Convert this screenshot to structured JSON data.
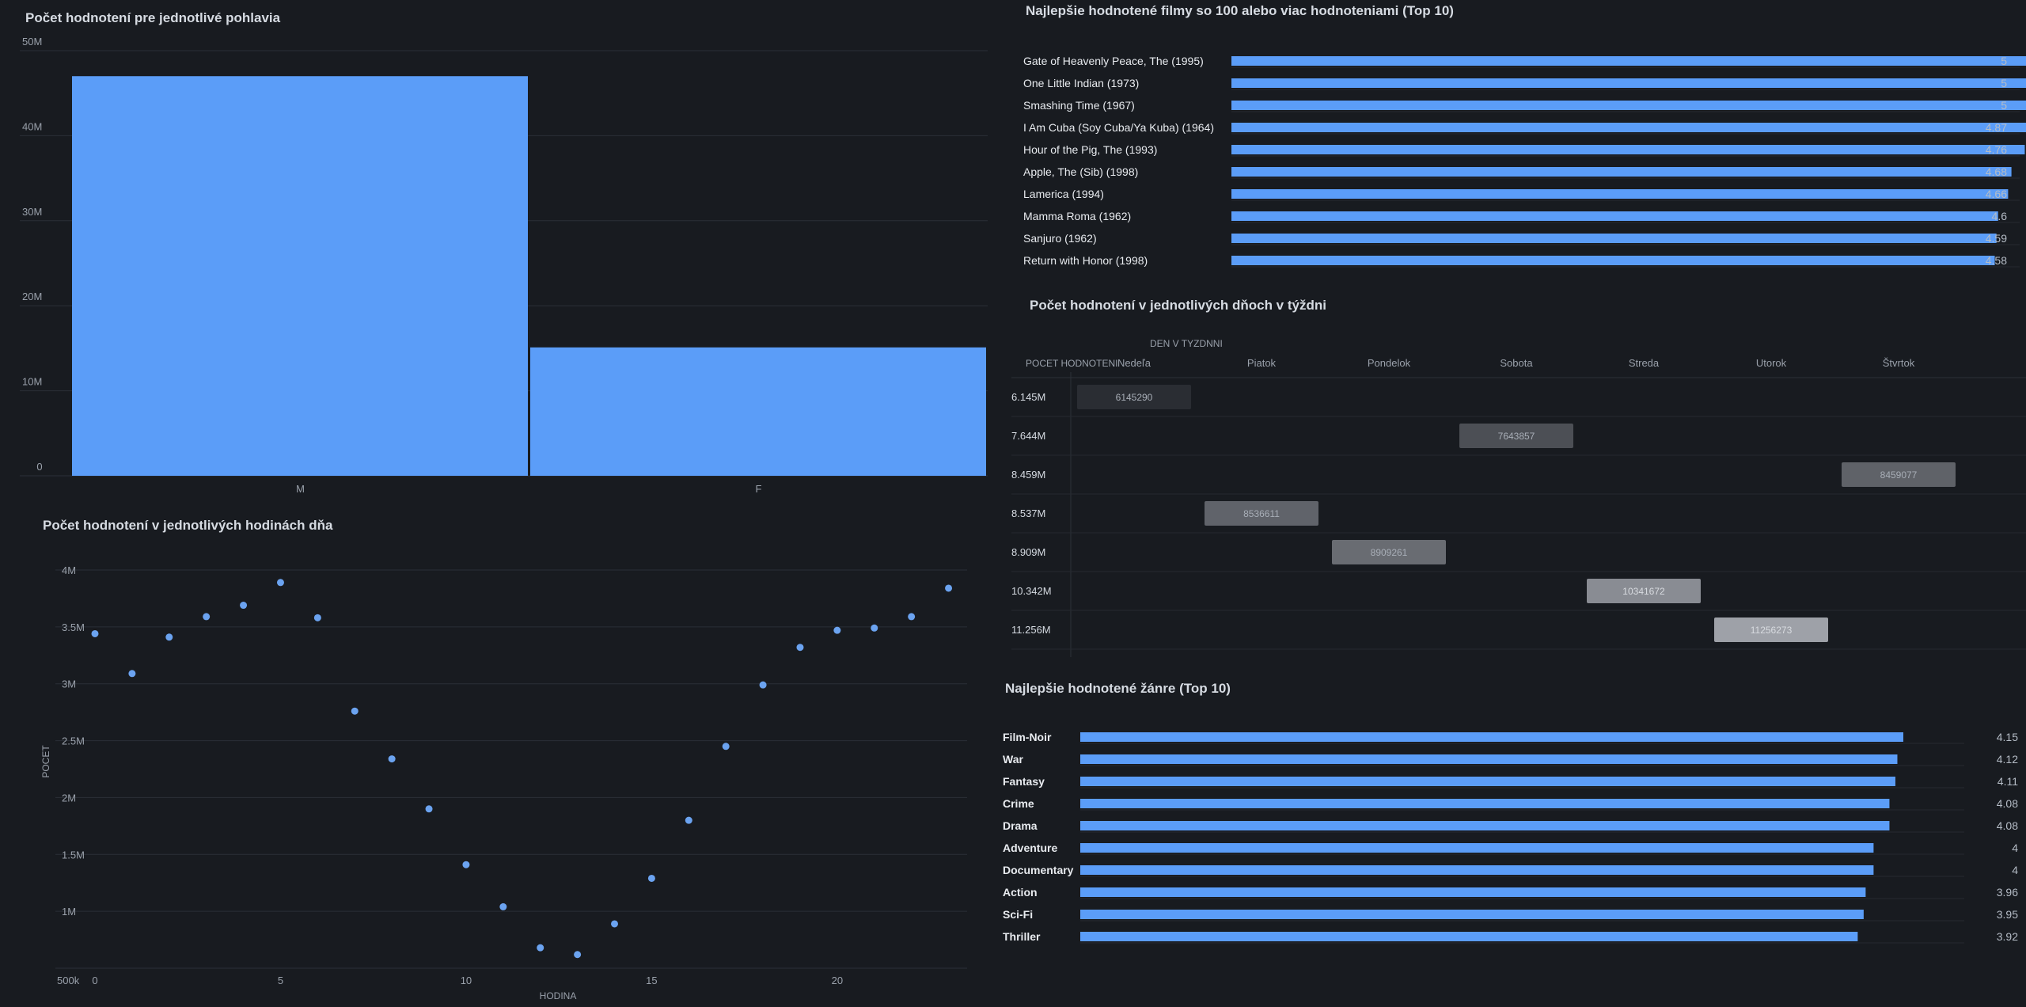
{
  "chart_data": [
    {
      "id": "gender",
      "type": "bar",
      "title": "Počet hodnotení pre jednotlivé pohlavia",
      "categories": [
        "M",
        "F"
      ],
      "values": [
        47000000,
        15100000
      ],
      "ylim": [
        0,
        50000000
      ],
      "yticks": [
        0,
        10000000,
        20000000,
        30000000,
        40000000,
        50000000
      ],
      "ytick_labels": [
        "0",
        "10M",
        "20M",
        "30M",
        "40M",
        "50M"
      ],
      "grid": true
    },
    {
      "id": "top_movies",
      "type": "bar",
      "orientation": "horizontal",
      "title": "Najlepšie hodnotené filmy so 100 alebo viac hodnoteniami (Top 10)",
      "categories": [
        "Gate of Heavenly Peace, The (1995)",
        "One Little Indian (1973)",
        "Smashing Time (1967)",
        "I Am Cuba (Soy Cuba/Ya Kuba) (1964)",
        "Hour of the Pig, The (1993)",
        "Apple, The (Sib) (1998)",
        "Lamerica (1994)",
        "Mamma Roma (1962)",
        "Sanjuro (1962)",
        "Return with Honor (1998)"
      ],
      "values": [
        5,
        5,
        5,
        4.87,
        4.76,
        4.68,
        4.66,
        4.6,
        4.59,
        4.58
      ],
      "value_labels": [
        "5",
        "5",
        "5",
        "4.87",
        "4.76",
        "4.68",
        "4.66",
        "4.6",
        "4.59",
        "4.58"
      ],
      "xlim": [
        0,
        5
      ]
    },
    {
      "id": "days",
      "type": "heatmap",
      "title": "Počet hodnotení v jednotlivých dňoch v týždni",
      "col_axis_label": "DEN V TYZDNNI",
      "row_axis_label": "POCET HODNOTENI",
      "columns": [
        "Nedeľa",
        "Piatok",
        "Pondelok",
        "Sobota",
        "Streda",
        "Utorok",
        "Štvrtok"
      ],
      "rows": [
        {
          "label": "6.145M",
          "col": 0,
          "value": 6145290,
          "value_label": "6145290"
        },
        {
          "label": "7.644M",
          "col": 3,
          "value": 7643857,
          "value_label": "7643857"
        },
        {
          "label": "8.459M",
          "col": 6,
          "value": 8459077,
          "value_label": "8459077"
        },
        {
          "label": "8.537M",
          "col": 1,
          "value": 8536611,
          "value_label": "8536611"
        },
        {
          "label": "8.909M",
          "col": 2,
          "value": 8909261,
          "value_label": "8909261"
        },
        {
          "label": "10.342M",
          "col": 4,
          "value": 10341672,
          "value_label": "10341672"
        },
        {
          "label": "11.256M",
          "col": 5,
          "value": 11256273,
          "value_label": "11256273"
        }
      ]
    },
    {
      "id": "hours",
      "type": "scatter",
      "title": "Počet hodnotení v jednotlivých hodinách dňa",
      "xlabel": "HODINA",
      "ylabel": "POCET",
      "x": [
        0,
        1,
        2,
        3,
        4,
        5,
        6,
        7,
        8,
        9,
        10,
        11,
        12,
        13,
        14,
        15,
        16,
        17,
        18,
        19,
        20,
        21,
        22,
        23
      ],
      "y": [
        3440000,
        3090000,
        3410000,
        3590000,
        3690000,
        3890000,
        3580000,
        2760000,
        2340000,
        1900000,
        1410000,
        1040000,
        680000,
        620000,
        890000,
        1290000,
        1800000,
        2450000,
        2990000,
        3320000,
        3470000,
        3490000,
        3590000,
        3840000
      ],
      "xlim": [
        0,
        23.5
      ],
      "ylim": [
        500000,
        4000000
      ],
      "xticks": [
        0,
        5,
        10,
        15,
        20
      ],
      "yticks": [
        500000,
        1000000,
        1500000,
        2000000,
        2500000,
        3000000,
        3500000,
        4000000
      ],
      "ytick_labels": [
        "500k",
        "1M",
        "1.5M",
        "2M",
        "2.5M",
        "3M",
        "3.5M",
        "4M"
      ],
      "grid": true
    },
    {
      "id": "top_genres",
      "type": "bar",
      "orientation": "horizontal",
      "title": "Najlepšie hodnotené žánre (Top 10)",
      "categories": [
        "Film-Noir",
        "War",
        "Fantasy",
        "Crime",
        "Drama",
        "Adventure",
        "Documentary",
        "Action",
        "Sci-Fi",
        "Thriller"
      ],
      "values": [
        4.15,
        4.12,
        4.11,
        4.08,
        4.08,
        4,
        4,
        3.96,
        3.95,
        3.92
      ],
      "value_labels": [
        "4.15",
        "4.12",
        "4.11",
        "4.08",
        "4.08",
        "4",
        "4",
        "3.96",
        "3.95",
        "3.92"
      ],
      "xlim": [
        0,
        5
      ]
    }
  ],
  "colors": {
    "bar": "#5b9df8",
    "point": "#6ba3f0",
    "grid": "#2a2f37",
    "heat_low": "#2a2d33",
    "heat_high": "#9ea1a8"
  }
}
